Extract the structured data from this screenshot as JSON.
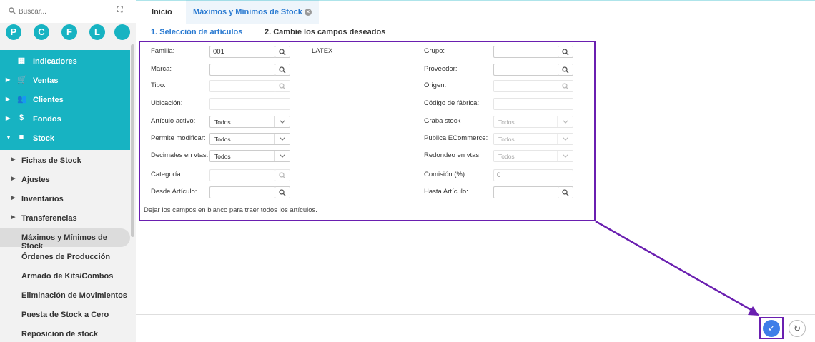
{
  "search": {
    "placeholder": "Buscar..."
  },
  "quick_access": [
    "P",
    "C",
    "F",
    "L",
    ""
  ],
  "main_menu": [
    {
      "label": "Indicadores",
      "icon": "dashboard-icon"
    },
    {
      "label": "Ventas",
      "icon": "cart-icon"
    },
    {
      "label": "Clientes",
      "icon": "people-icon"
    },
    {
      "label": "Fondos",
      "icon": "dollar-icon"
    },
    {
      "label": "Stock",
      "icon": "box-icon"
    }
  ],
  "stock_submenu": [
    {
      "label": "Fichas de Stock"
    },
    {
      "label": "Ajustes"
    },
    {
      "label": "Inventarios"
    },
    {
      "label": "Transferencias"
    },
    {
      "label": "Máximos y Mínimos de Stock"
    },
    {
      "label": "Órdenes de Producción"
    },
    {
      "label": "Armado de Kits/Combos"
    },
    {
      "label": "Eliminación de Movimientos"
    },
    {
      "label": "Puesta de Stock a Cero"
    },
    {
      "label": "Reposicion de stock"
    }
  ],
  "tabs": [
    {
      "label": "Inicio"
    },
    {
      "label": "Máximos y Mínimos de Stock"
    }
  ],
  "steps": [
    {
      "label": "1. Selección de artículos"
    },
    {
      "label": "2. Cambie los campos deseados"
    }
  ],
  "form": {
    "familia": {
      "label": "Familia:",
      "value": "001",
      "description": "LATEX"
    },
    "marca": {
      "label": "Marca:",
      "value": ""
    },
    "tipo": {
      "label": "Tipo:",
      "value": ""
    },
    "ubicacion": {
      "label": "Ubicación:",
      "value": ""
    },
    "articulo_activo": {
      "label": "Artículo activo:",
      "value": "Todos"
    },
    "permite_modificar": {
      "label": "Permite modificar:",
      "value": "Todos"
    },
    "decimales_vtas": {
      "label": "Decimales en vtas:",
      "value": "Todos"
    },
    "categoria": {
      "label": "Categoría:",
      "value": ""
    },
    "desde_articulo": {
      "label": "Desde Artículo:",
      "value": ""
    },
    "grupo": {
      "label": "Grupo:",
      "value": ""
    },
    "proveedor": {
      "label": "Proveedor:",
      "value": ""
    },
    "origen": {
      "label": "Origen:",
      "value": ""
    },
    "codigo_fabrica": {
      "label": "Código de fábrica:",
      "value": ""
    },
    "graba_stock": {
      "label": "Graba stock",
      "value": "Todos"
    },
    "publica_ecommerce": {
      "label": "Publica ECommerce:",
      "value": "Todos"
    },
    "redondeo_vtas": {
      "label": "Redondeo en vtas:",
      "value": "Todos"
    },
    "comision": {
      "label": "Comisión (%):",
      "value": "0"
    },
    "hasta_articulo": {
      "label": "Hasta Artículo:",
      "value": ""
    },
    "hint": "Dejar los campos en blanco para traer todos los artículos."
  },
  "colors": {
    "accent": "#17b3c2",
    "annotation": "#6a1fb0",
    "primary_button": "#3f7ee8",
    "active_tab_text": "#2a7ad1"
  }
}
